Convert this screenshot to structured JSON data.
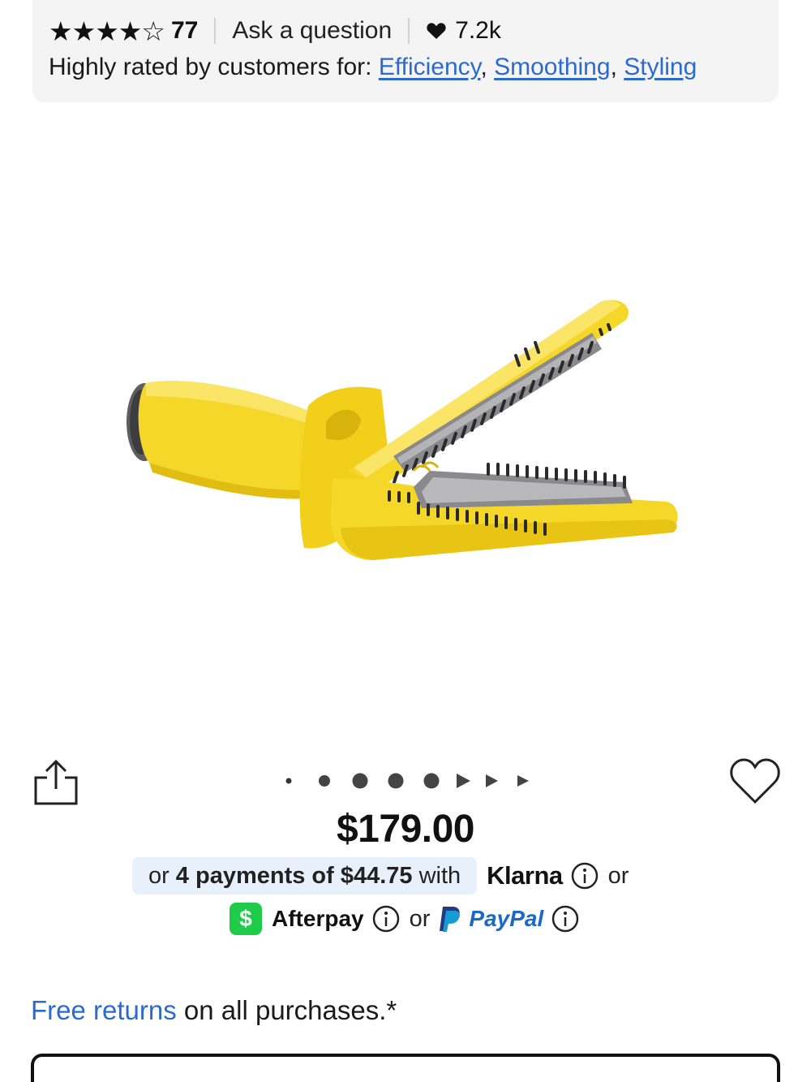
{
  "rating": {
    "stars_filled": 4,
    "stars_total": 5,
    "review_count": "77",
    "ask_question_label": "Ask a question",
    "loves_count": "7.2k",
    "heart_icon": "heart-filled-icon"
  },
  "highly_rated": {
    "prefix": "Highly rated by customers for: ",
    "tags": [
      "Efficiency",
      "Smoothing",
      "Styling"
    ]
  },
  "product_image": {
    "description_icon": "blow-dryer-brush-image",
    "primary_color": "#f5d72a"
  },
  "carousel": {
    "current_index": 3,
    "total_visible": 8
  },
  "price": "$179.00",
  "klarna": {
    "prefix": "or",
    "payments_text": "4 payments of $44.75",
    "with_text": "with",
    "brand": "Klarna",
    "or_text": "or"
  },
  "alt_payments": {
    "afterpay_badge": "$",
    "afterpay_label": "Afterpay",
    "or_text": "or",
    "paypal_label": "PayPal"
  },
  "returns": {
    "link_text": "Free returns",
    "rest_text": " on all purchases.*"
  },
  "colors": {
    "link": "#2c6ad0",
    "afterpay": "#1fcc4a",
    "paypal": "#1f67c7",
    "klarna_pill": "#e8f1fb"
  }
}
